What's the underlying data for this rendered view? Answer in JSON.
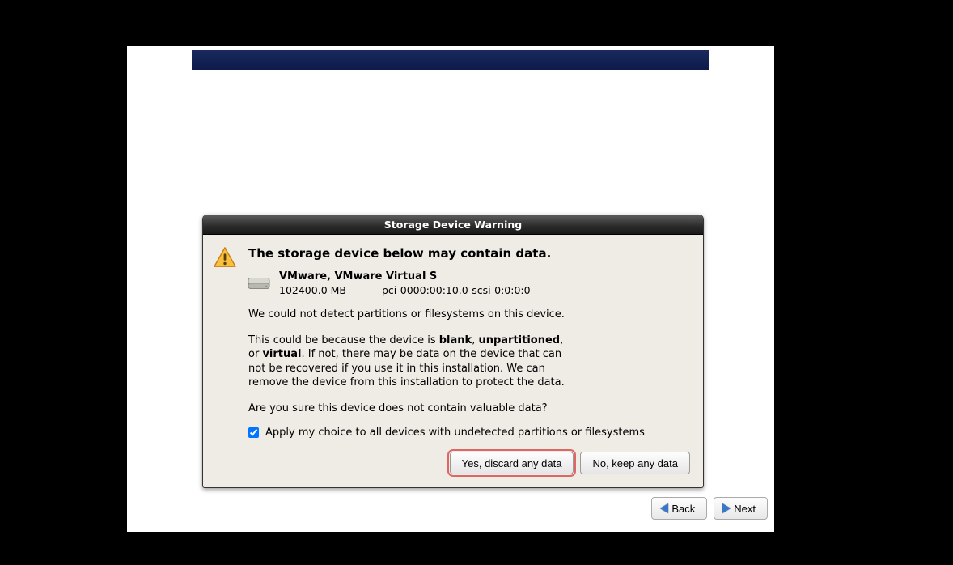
{
  "dialog": {
    "title": "Storage Device Warning",
    "heading": "The storage device below may contain data.",
    "device": {
      "name": "VMware, VMware Virtual S",
      "size": "102400.0 MB",
      "path": "pci-0000:00:10.0-scsi-0:0:0:0"
    },
    "para1": "We could not detect partitions or filesystems on this device.",
    "para2_a": "This could be because the device is ",
    "para2_blank": "blank",
    "para2_b": ", ",
    "para2_unpart": "unpartitioned",
    "para2_c": ", or ",
    "para2_virtual": "virtual",
    "para2_d": ". If not, there may be data on the device that can not be recovered if you use it in this installation. We can remove the device from this installation to protect the data.",
    "para3": "Are you sure this device does not contain valuable data?",
    "checkbox_label": "Apply my choice to all devices with undetected partitions or filesystems",
    "checkbox_checked": true,
    "yes_label": "Yes, discard any data",
    "no_label": "No, keep any data"
  },
  "nav": {
    "back_label": "Back",
    "next_label": "Next"
  }
}
